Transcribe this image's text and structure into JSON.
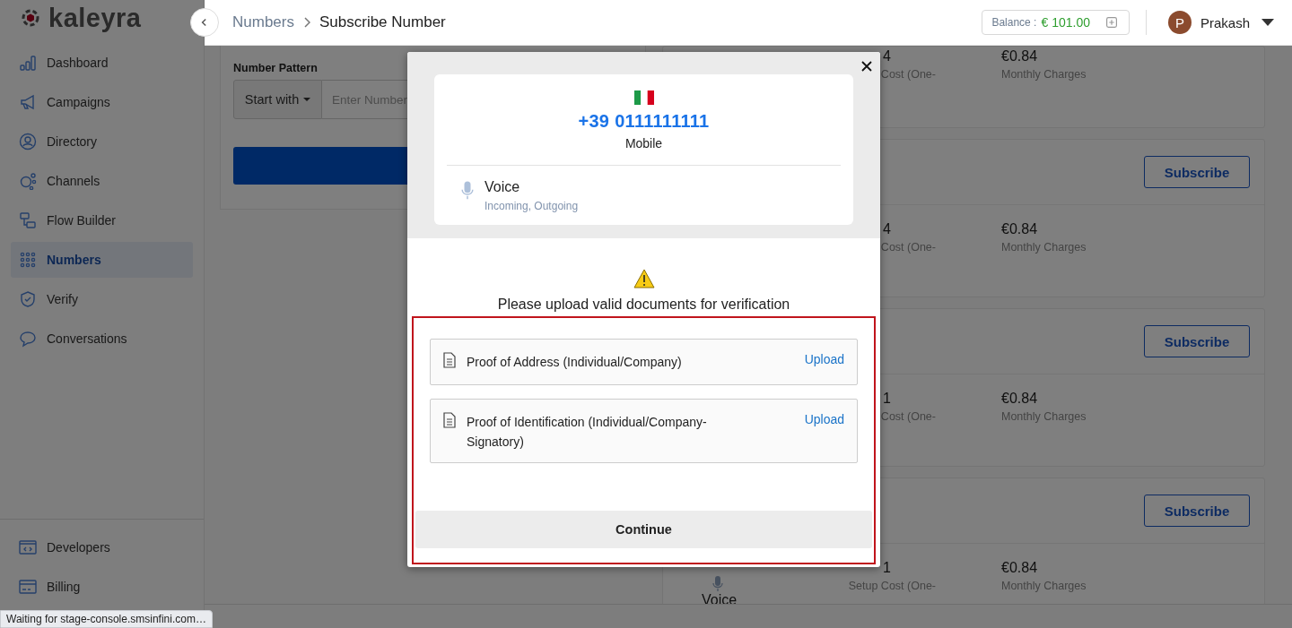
{
  "logo": {
    "text": "kaleyra"
  },
  "sidebar": {
    "items": [
      {
        "label": "Dashboard",
        "selected": false
      },
      {
        "label": "Campaigns",
        "selected": false
      },
      {
        "label": "Directory",
        "selected": false
      },
      {
        "label": "Channels",
        "selected": false
      },
      {
        "label": "Flow Builder",
        "selected": false
      },
      {
        "label": "Numbers",
        "selected": true
      },
      {
        "label": "Verify",
        "selected": false
      },
      {
        "label": "Conversations",
        "selected": false
      }
    ],
    "bottom_items": [
      {
        "label": "Developers",
        "selected": false
      },
      {
        "label": "Billing",
        "selected": false
      }
    ]
  },
  "header": {
    "breadcrumb": [
      "Numbers",
      "Subscribe Number"
    ],
    "balance_label": "Balance :",
    "balance_value": "€ 101.00",
    "user": {
      "initial": "P",
      "name": "Prakash"
    }
  },
  "search_panel": {
    "label": "Number Pattern",
    "match_button": "Start with",
    "placeholder": "Enter Number"
  },
  "results": [
    {
      "setup_price": "4",
      "setup_label": "Cost (One-",
      "monthly_price": "€0.84",
      "monthly_label": "Monthly Charges"
    },
    {
      "subscribe": "Subscribe",
      "setup_price": "4",
      "setup_label": "Cost (One-",
      "monthly_price": "€0.84",
      "monthly_label": "Monthly Charges"
    },
    {
      "subscribe": "Subscribe",
      "setup_price": "1",
      "setup_label": "Cost (One-",
      "monthly_price": "€0.84",
      "monthly_label": "Monthly Charges"
    },
    {
      "subscribe": "Subscribe",
      "setup_price": "1",
      "setup_label": "Setup Cost (One-",
      "monthly_price": "€0.84",
      "monthly_label": "Monthly Charges",
      "channel": "Voice"
    }
  ],
  "dialog": {
    "number": "+39 0111111111",
    "number_type": "Mobile",
    "service": {
      "name": "Voice",
      "directions": "Incoming, Outgoing"
    },
    "message": "Please upload valid documents for verification",
    "documents": [
      {
        "name": "Proof of Address (Individual/Company)",
        "action": "Upload"
      },
      {
        "name": "Proof of Identification (Individual/Company-Signatory)",
        "action": "Upload"
      }
    ],
    "continue": "Continue"
  },
  "status_bar": "Waiting for stage-console.smsinfini.com…"
}
